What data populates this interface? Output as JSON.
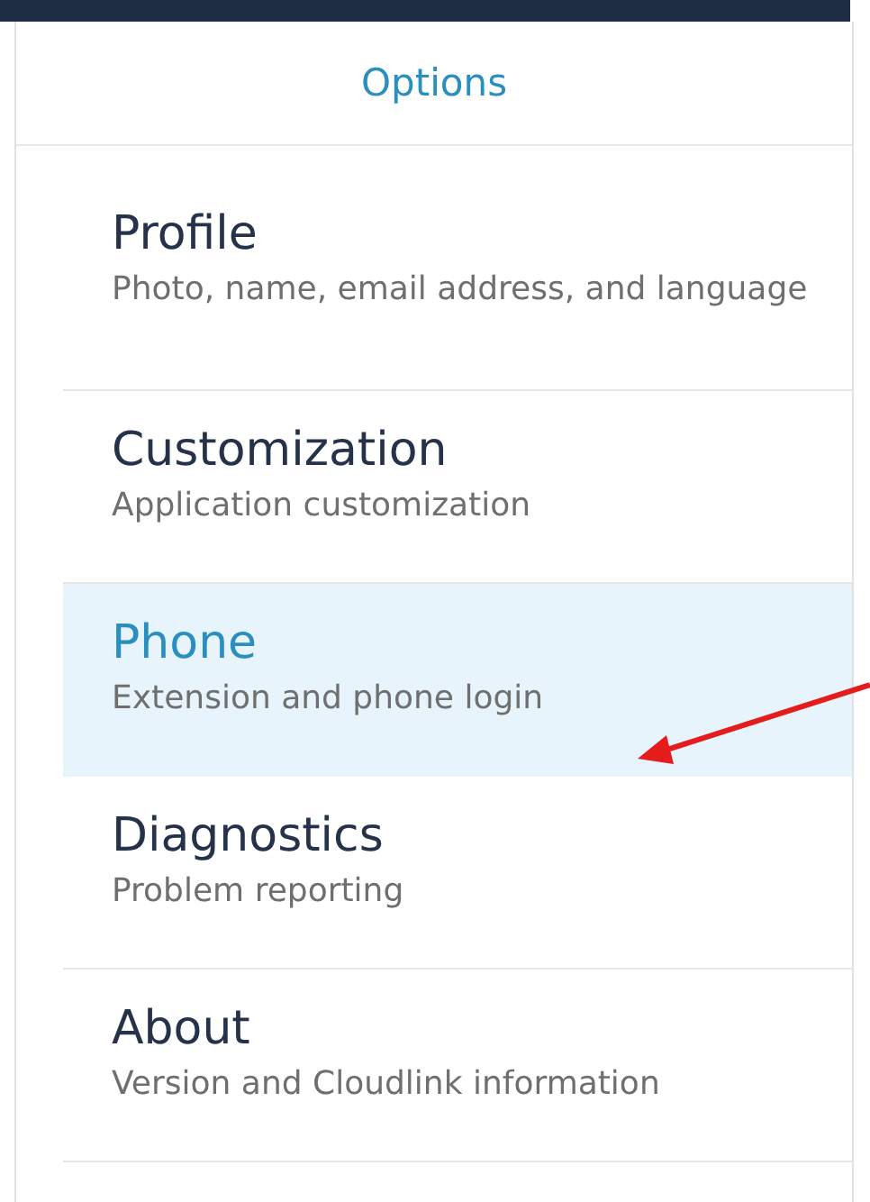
{
  "header": {
    "title": "Options"
  },
  "items": [
    {
      "title": "Profile",
      "description": "Photo, name, email address, and language",
      "selected": false
    },
    {
      "title": "Customization",
      "description": "Application customization",
      "selected": false
    },
    {
      "title": "Phone",
      "description": "Extension and phone login",
      "selected": true
    },
    {
      "title": "Diagnostics",
      "description": "Problem reporting",
      "selected": false
    },
    {
      "title": "About",
      "description": "Version and Cloudlink information",
      "selected": false
    }
  ]
}
